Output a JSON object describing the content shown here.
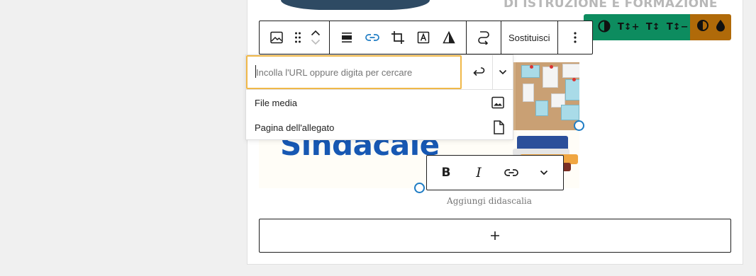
{
  "banner": {
    "text": "DI ISTRUZIONE E FORMAZIONE"
  },
  "accessibility_toolbar": {
    "buttons": [
      {
        "icon": "contrast-circle-icon",
        "label": ""
      },
      {
        "icon": "text-increase-icon",
        "label": "T↕+"
      },
      {
        "icon": "text-line-height-icon",
        "label": "T↕"
      },
      {
        "icon": "text-decrease-icon",
        "label": "T↕−"
      },
      {
        "icon": "half-contrast-icon",
        "label": ""
      },
      {
        "icon": "ink-drop-icon",
        "label": ""
      }
    ],
    "colors": {
      "green": "#0d8c5f",
      "orange": "#b06a09"
    }
  },
  "block_toolbar": {
    "replace_label": "Sostituisci",
    "link_color": "#1e7cc4"
  },
  "link_popover": {
    "url_placeholder": "Incolla l'URL oppure digita per cercare",
    "suggestions": [
      {
        "label": "File media",
        "icon": "media-image-icon"
      },
      {
        "label": "Pagina dell'allegato",
        "icon": "page-document-icon"
      }
    ],
    "focus_color": "#f0b849"
  },
  "image": {
    "visible_text": "Sindacale",
    "title_color": "#1758b3"
  },
  "caption": {
    "placeholder": "Aggiungi didascalia"
  },
  "appender": {
    "label": "+"
  }
}
